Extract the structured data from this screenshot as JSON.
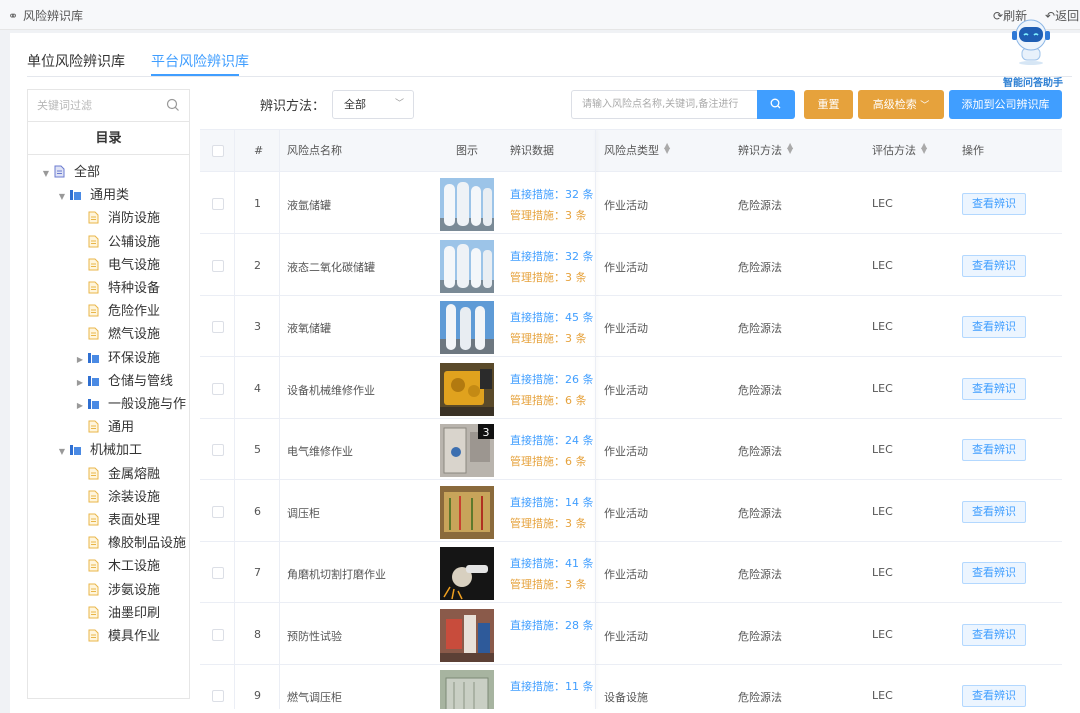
{
  "breadcrumb": "风险辨识库",
  "header": {
    "refresh_label": "刷新",
    "back_label": "返回"
  },
  "assistant": {
    "label": "智能问答助手"
  },
  "tabs": [
    {
      "label": "单位风险辨识库"
    },
    {
      "label": "平台风险辨识库"
    }
  ],
  "sidebar": {
    "filter_placeholder": "关键词过滤",
    "directory_title": "目录",
    "tree": [
      {
        "label": "全部",
        "level": 0,
        "expanded": true,
        "type": "doc"
      },
      {
        "label": "通用类",
        "level": 1,
        "expanded": true,
        "type": "folder"
      },
      {
        "label": "消防设施",
        "level": 2,
        "type": "file"
      },
      {
        "label": "公辅设施",
        "level": 2,
        "type": "file"
      },
      {
        "label": "电气设施",
        "level": 2,
        "type": "file"
      },
      {
        "label": "特种设备",
        "level": 2,
        "type": "file"
      },
      {
        "label": "危险作业",
        "level": 2,
        "type": "file"
      },
      {
        "label": "燃气设施",
        "level": 2,
        "type": "file"
      },
      {
        "label": "环保设施",
        "level": 2,
        "expanded": false,
        "type": "folder"
      },
      {
        "label": "仓储与管线",
        "level": 2,
        "expanded": false,
        "type": "folder"
      },
      {
        "label": "一般设施与作",
        "level": 2,
        "expanded": false,
        "type": "folder"
      },
      {
        "label": "通用",
        "level": 2,
        "type": "file"
      },
      {
        "label": "机械加工",
        "level": 1,
        "expanded": true,
        "type": "folder"
      },
      {
        "label": "金属熔融",
        "level": 2,
        "type": "file"
      },
      {
        "label": "涂装设施",
        "level": 2,
        "type": "file"
      },
      {
        "label": "表面处理",
        "level": 2,
        "type": "file"
      },
      {
        "label": "橡胶制品设施",
        "level": 2,
        "type": "file"
      },
      {
        "label": "木工设施",
        "level": 2,
        "type": "file"
      },
      {
        "label": "涉氨设施",
        "level": 2,
        "type": "file"
      },
      {
        "label": "油墨印刷",
        "level": 2,
        "type": "file"
      },
      {
        "label": "模具作业",
        "level": 2,
        "type": "file"
      }
    ]
  },
  "toolbar": {
    "method_label": "辨识方法：",
    "method_value": "全部",
    "search_placeholder": "请输入风险点名称,关键词,备注进行",
    "reset_label": "重置",
    "advanced_label": "高级检索",
    "add_label": "添加到公司辨识库"
  },
  "table": {
    "headers": {
      "index": "#",
      "name": "风险点名称",
      "image": "图示",
      "data": "辨识数据",
      "type": "风险点类型",
      "method": "辨识方法",
      "eval": "评估方法",
      "action": "操作"
    },
    "rows": [
      {
        "index": "1",
        "name": "液氩储罐",
        "direct": "直接措施：32 条",
        "manage": "管理措施：3 条",
        "type": "作业活动",
        "method": "危险源法",
        "eval": "LEC",
        "action": "查看辨识",
        "img": "tank"
      },
      {
        "index": "2",
        "name": "液态二氧化碳储罐",
        "direct": "直接措施：32 条",
        "manage": "管理措施：3 条",
        "type": "作业活动",
        "method": "危险源法",
        "eval": "LEC",
        "action": "查看辨识",
        "img": "tank"
      },
      {
        "index": "3",
        "name": "液氧储罐",
        "direct": "直接措施：45 条",
        "manage": "管理措施：3 条",
        "type": "作业活动",
        "method": "危险源法",
        "eval": "LEC",
        "action": "查看辨识",
        "img": "tank2"
      },
      {
        "index": "4",
        "name": "设备机械维修作业",
        "direct": "直接措施：26 条",
        "manage": "管理措施：6 条",
        "type": "作业活动",
        "method": "危险源法",
        "eval": "LEC",
        "action": "查看辨识",
        "img": "engine"
      },
      {
        "index": "5",
        "name": "电气维修作业",
        "direct": "直接措施：24 条",
        "manage": "管理措施：6 条",
        "type": "作业活动",
        "method": "危险源法",
        "eval": "LEC",
        "action": "查看辨识",
        "img": "electric",
        "img_badge": "3"
      },
      {
        "index": "6",
        "name": "调压柜",
        "direct": "直接措施：14 条",
        "manage": "管理措施：3 条",
        "type": "作业活动",
        "method": "危险源法",
        "eval": "LEC",
        "action": "查看辨识",
        "img": "cabinet"
      },
      {
        "index": "7",
        "name": "角磨机切割打磨作业",
        "direct": "直接措施：41 条",
        "manage": "管理措施：3 条",
        "type": "作业活动",
        "method": "危险源法",
        "eval": "LEC",
        "action": "查看辨识",
        "img": "grinder"
      },
      {
        "index": "8",
        "name": "预防性试验",
        "direct": "直接措施：28 条",
        "manage": "",
        "type": "作业活动",
        "method": "危险源法",
        "eval": "LEC",
        "action": "查看辨识",
        "img": "test"
      },
      {
        "index": "9",
        "name": "燃气调压柜",
        "direct": "直接措施：11 条",
        "manage": "",
        "type": "设备设施",
        "method": "危险源法",
        "eval": "LEC",
        "action": "查看辨识",
        "img": "box"
      }
    ]
  },
  "colors": {
    "primary": "#409eff",
    "warning": "#e6a23c"
  }
}
